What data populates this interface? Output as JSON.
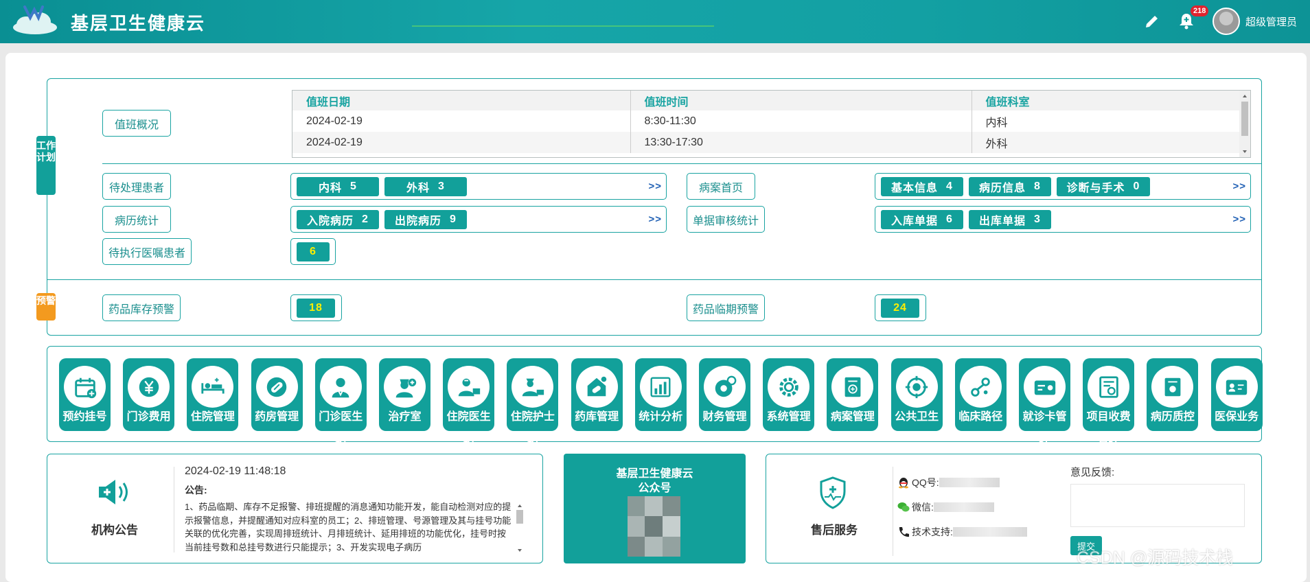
{
  "app": {
    "title": "基层卫生健康云",
    "notification_count": "218",
    "user_name": "超级管理员"
  },
  "colors": {
    "primary": "#12a09a",
    "header": "#0f9a9d",
    "warning_tag": "#f39a1f",
    "link": "#1f5fb4",
    "highlight": "#ffee00"
  },
  "work_plan": {
    "tag": "工作计划",
    "duty_overview_label": "值班概况",
    "duty_table": {
      "headers": [
        "值班日期",
        "值班时间",
        "值班科室"
      ],
      "rows": [
        [
          "2024-02-19",
          "8:30-11:30",
          "内科"
        ],
        [
          "2024-02-19",
          "13:30-17:30",
          "外科"
        ]
      ]
    },
    "pending_patients": {
      "label": "待处理患者",
      "items": [
        {
          "name": "内科",
          "count": "5"
        },
        {
          "name": "外科",
          "count": "3"
        }
      ],
      "more": ">>"
    },
    "medical_record_home": {
      "label": "病案首页",
      "items": [
        {
          "name": "基本信息",
          "count": "4"
        },
        {
          "name": "病历信息",
          "count": "8"
        },
        {
          "name": "诊断与手术",
          "count": "0"
        }
      ],
      "more": ">>"
    },
    "record_stats": {
      "label": "病历统计",
      "items": [
        {
          "name": "入院病历",
          "count": "2"
        },
        {
          "name": "出院病历",
          "count": "9"
        }
      ],
      "more": ">>"
    },
    "voucher_audit": {
      "label": "单据审核统计",
      "items": [
        {
          "name": "入库单据",
          "count": "6"
        },
        {
          "name": "出库单据",
          "count": "3"
        }
      ],
      "more": ">>"
    },
    "pending_orders": {
      "label": "待执行医嘱患者",
      "count": "6"
    }
  },
  "warning": {
    "tag": "预警",
    "stock": {
      "label": "药品库存预警",
      "count": "18"
    },
    "expiry": {
      "label": "药品临期预警",
      "count": "24"
    }
  },
  "modules": [
    {
      "label": "预约挂号",
      "icon": "calendar-add-icon"
    },
    {
      "label": "门诊费用",
      "icon": "yuan-icon"
    },
    {
      "label": "住院管理",
      "icon": "hospital-bed-icon"
    },
    {
      "label": "药房管理",
      "icon": "pill-icon"
    },
    {
      "label": "门诊医生",
      "icon": "doctor-icon",
      "overflow": "站"
    },
    {
      "label": "治疗室",
      "icon": "nurse-icon"
    },
    {
      "label": "住院医生",
      "icon": "inpatient-doctor-icon",
      "overflow": "站"
    },
    {
      "label": "住院护士",
      "icon": "inpatient-nurse-icon",
      "overflow": "站"
    },
    {
      "label": "药库管理",
      "icon": "pharmacy-store-icon"
    },
    {
      "label": "统计分析",
      "icon": "bar-chart-icon"
    },
    {
      "label": "财务管理",
      "icon": "finance-gear-icon"
    },
    {
      "label": "系统管理",
      "icon": "system-gear-icon"
    },
    {
      "label": "病案管理",
      "icon": "medical-record-icon"
    },
    {
      "label": "公共卫生",
      "icon": "public-health-icon"
    },
    {
      "label": "临床路径",
      "icon": "clinical-path-icon"
    },
    {
      "label": "就诊卡管",
      "icon": "card-icon",
      "overflow": "理"
    },
    {
      "label": "项目收费",
      "icon": "project-fee-icon",
      "overflow": "管理"
    },
    {
      "label": "病历质控",
      "icon": "quality-control-icon"
    },
    {
      "label": "医保业务",
      "icon": "insurance-card-icon"
    }
  ],
  "announcement": {
    "title": "机构公告",
    "timestamp": "2024-02-19 11:48:18",
    "heading": "公告:",
    "body": "1、药品临期、库存不足报警、排班提醒的消息通知功能开发，能自动检测对应的提示报警信息，并提醒通知对应科室的员工；2、排班管理、号源管理及其与挂号功能关联的优化完善，实现周排班统计、月排班统计、延用排班的功能优化，挂号时按当前挂号数和总挂号数进行只能提示；3、开发实现电子病历"
  },
  "wechat": {
    "title": "基层卫生健康云",
    "subtitle": "公众号"
  },
  "after_sales": {
    "title": "售后服务",
    "qq_label": "QQ号:",
    "wechat_label": "微信:",
    "support_label": "技术支持:",
    "feedback_label": "意见反馈:",
    "submit_label": "提交"
  },
  "watermark": "CSDN @源码技术栈"
}
